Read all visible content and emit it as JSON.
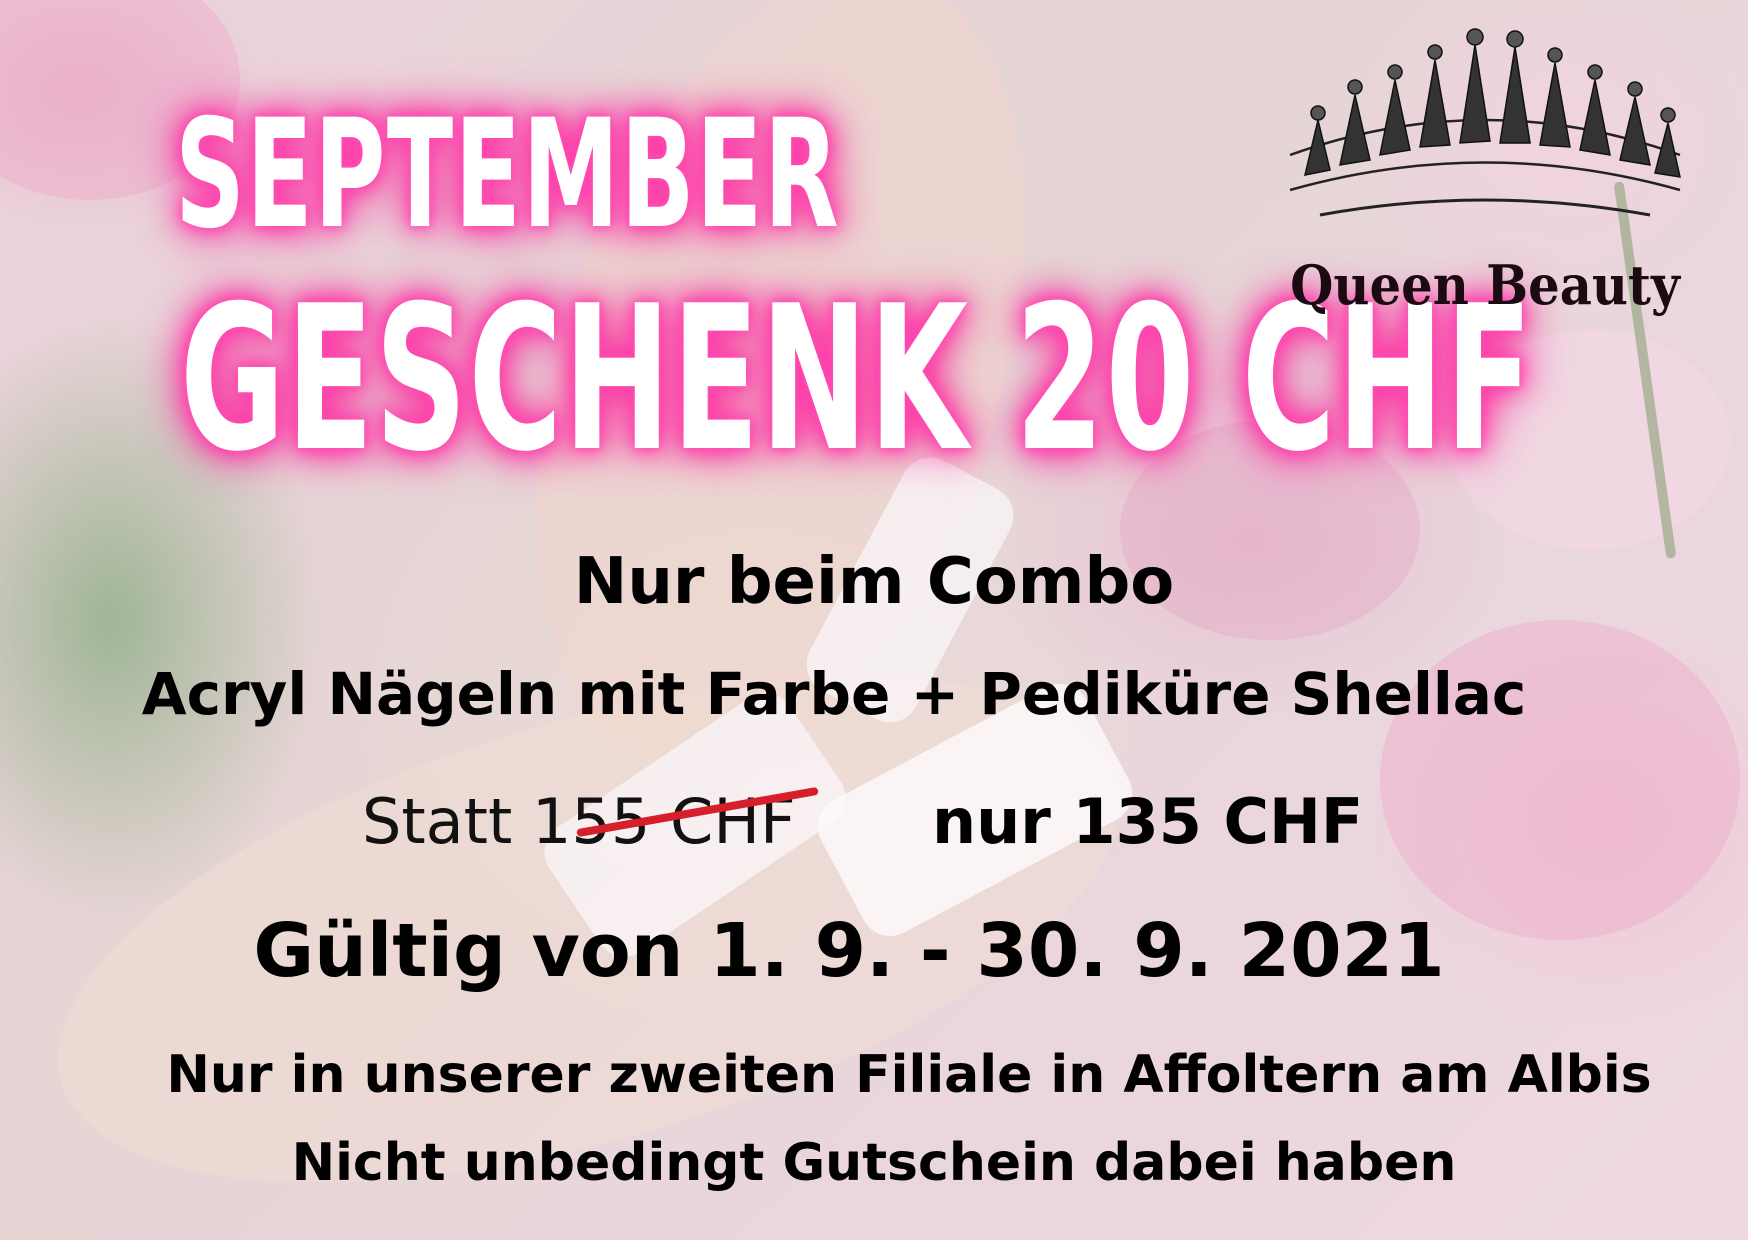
{
  "headline": {
    "line1": "SEPTEMBER",
    "line2": "GESCHENK 20 CHF"
  },
  "logo": {
    "brand": "Queen Beauty",
    "icon": "crown-icon"
  },
  "offer": {
    "line1": "Nur beim Combo",
    "line2": "Acryl Nägeln mit Farbe + Pediküre Shellac",
    "old_price": "Statt 155 CHF",
    "new_price": "nur 135 CHF",
    "validity": "Gültig von 1. 9. - 30. 9. 2021",
    "note1": "Nur in unserer zweiten Filiale in Affoltern am Albis",
    "note2": "Nicht unbedingt Gutschein dabei haben"
  },
  "colors": {
    "glow": "#ff3fae",
    "strike": "#d51f2a",
    "text": "#000000"
  }
}
